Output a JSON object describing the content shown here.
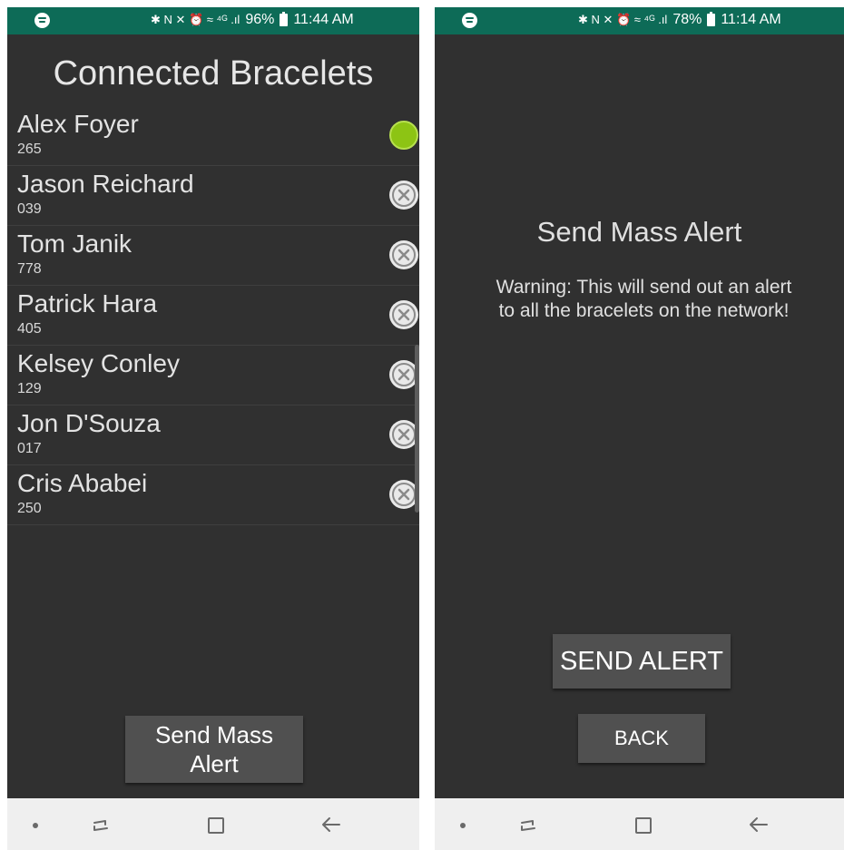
{
  "left_screen": {
    "status_bar": {
      "icons": "✱ N ✕ ⏰ ≈ ⁴ᴳ .ıl",
      "battery": "96%",
      "time": "11:44 AM"
    },
    "title": "Connected Bracelets",
    "bracelets": [
      {
        "name": "Alex Foyer",
        "id": "265",
        "status": "connected"
      },
      {
        "name": "Jason Reichard",
        "id": "039",
        "status": "disconnected"
      },
      {
        "name": "Tom Janik",
        "id": "778",
        "status": "disconnected"
      },
      {
        "name": "Patrick Hara",
        "id": "405",
        "status": "disconnected"
      },
      {
        "name": "Kelsey Conley",
        "id": "129",
        "status": "disconnected"
      },
      {
        "name": "Jon D'Souza",
        "id": "017",
        "status": "disconnected"
      },
      {
        "name": "Cris Ababei",
        "id": "250",
        "status": "disconnected"
      }
    ],
    "send_mass_alert_line1": "Send Mass",
    "send_mass_alert_line2": "Alert"
  },
  "right_screen": {
    "status_bar": {
      "icons": "✱ N ✕ ⏰ ≈ ⁴ᴳ .ıl",
      "battery": "78%",
      "time": "11:14 AM"
    },
    "title": "Send Mass Alert",
    "warning_line1": "Warning: This will send out an alert",
    "warning_line2": "to all the bracelets on the network!",
    "send_alert_label": "SEND ALERT",
    "back_label": "BACK"
  },
  "colors": {
    "status_bar": "#0d6b57",
    "background": "#303030",
    "button": "#505050",
    "connected": "#8dc414",
    "disconnected": "#e9e9e9",
    "navbar": "#efefef"
  },
  "icons": {
    "connected_indicator": "green-circle-icon",
    "disconnected_indicator": "x-circle-icon",
    "nav": [
      "dot-icon",
      "recent-apps-icon",
      "home-icon",
      "back-arrow-icon"
    ]
  }
}
